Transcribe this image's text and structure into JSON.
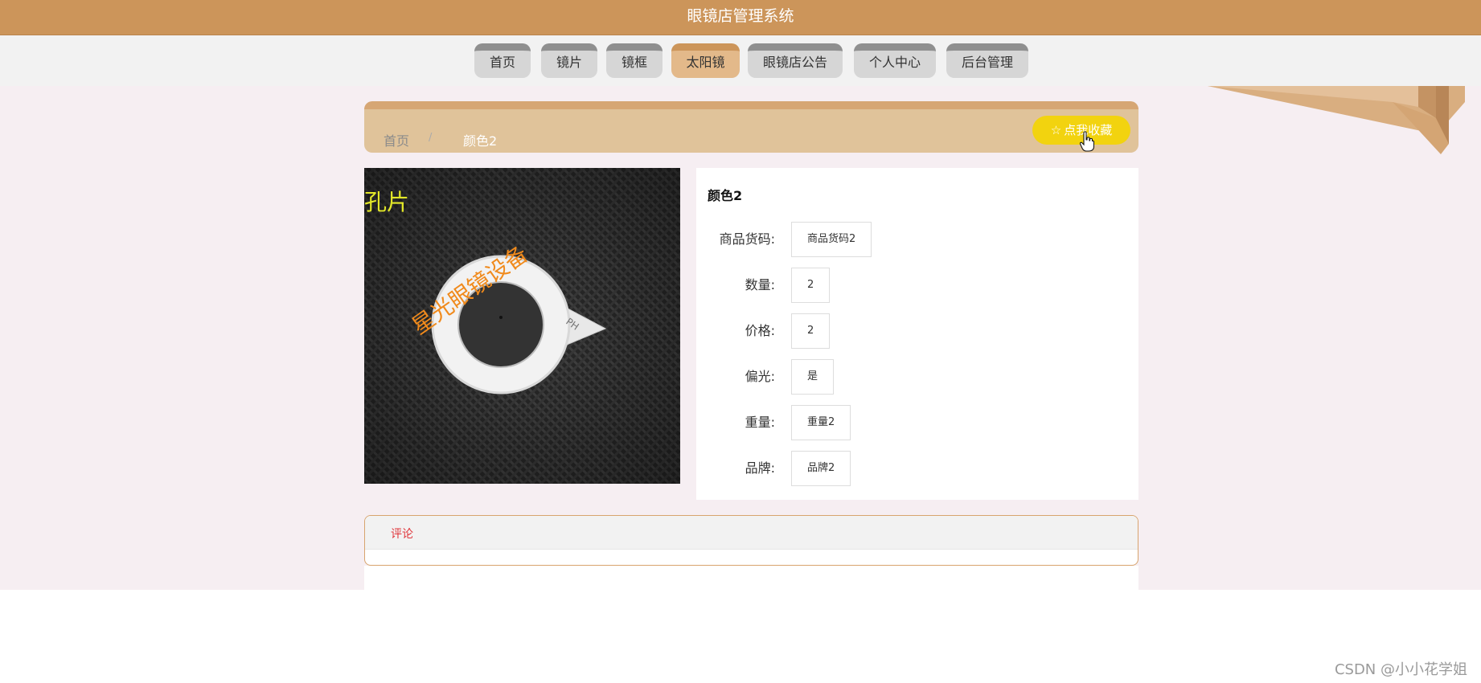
{
  "header": {
    "title": "眼镜店管理系统"
  },
  "nav": {
    "items": [
      {
        "label": "首页"
      },
      {
        "label": "镜片"
      },
      {
        "label": "镜框"
      },
      {
        "label": "太阳镜",
        "active": true
      },
      {
        "label": "眼镜店公告"
      },
      {
        "label": "个人中心"
      },
      {
        "label": "后台管理"
      }
    ]
  },
  "breadcrumb": {
    "home": "首页",
    "separator": "/",
    "current": "颜色2"
  },
  "favorite": {
    "icon": "star-outline-icon",
    "label": "点我收藏"
  },
  "product": {
    "image_text_top": "孔片",
    "image_watermark": "星光眼镜设备",
    "image_label": "PH",
    "title": "颜色2",
    "fields": [
      {
        "label": "商品货码:",
        "value": "商品货码2"
      },
      {
        "label": "数量:",
        "value": "2"
      },
      {
        "label": "价格:",
        "value": "2"
      },
      {
        "label": "偏光:",
        "value": "是"
      },
      {
        "label": "重量:",
        "value": "重量2"
      },
      {
        "label": "品牌:",
        "value": "品牌2"
      }
    ]
  },
  "comments": {
    "tab_label": "评论"
  },
  "footer": {
    "watermark": "CSDN @小小花学姐"
  },
  "colors": {
    "brand": "#cc955a",
    "nav_active": "#e3b98a",
    "favorite": "#f2d30f",
    "comment_tab": "#e0363b",
    "page_bg": "#f6eef2"
  }
}
